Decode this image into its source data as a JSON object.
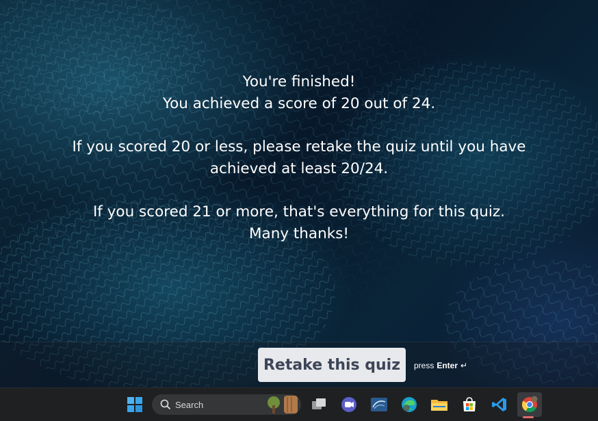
{
  "message": {
    "line1": "You're finished!",
    "line2": "You achieved a score of 20 out of 24.",
    "line3": "If you scored 20 or less, please retake the quiz until you have achieved at least 20/24.",
    "line4": "If you scored 21 or more, that's everything for this quiz.",
    "line5": "Many thanks!"
  },
  "actions": {
    "retake_label": "Retake this quiz",
    "press_label": "press",
    "key_label": "Enter",
    "key_glyph": "↵"
  },
  "taskbar": {
    "search_label": "Search",
    "apps": [
      "windows-start",
      "task-view",
      "teams-chat",
      "sql-server-management-studio",
      "edge-browser",
      "file-explorer",
      "microsoft-store",
      "vs-code",
      "chrome"
    ],
    "active_app": "chrome"
  },
  "colors": {
    "background": "#061522",
    "text": "#ffffff",
    "button_bg": "#e7e9ec",
    "button_text": "#3d4557",
    "taskbar_bg": "#1f2022"
  }
}
